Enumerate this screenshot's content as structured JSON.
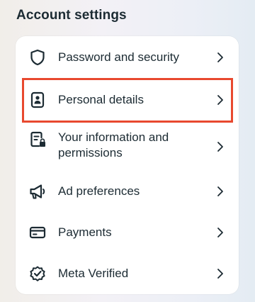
{
  "section": {
    "title": "Account settings"
  },
  "items": [
    {
      "label": "Password and security",
      "icon": "shield-icon"
    },
    {
      "label": "Personal details",
      "icon": "id-card-icon"
    },
    {
      "label": "Your information and permissions",
      "label_line1": "Your information and",
      "label_line2": "permissions",
      "icon": "document-lock-icon"
    },
    {
      "label": "Ad preferences",
      "icon": "megaphone-icon"
    },
    {
      "label": "Payments",
      "icon": "credit-card-icon"
    },
    {
      "label": "Meta Verified",
      "icon": "verified-badge-icon"
    }
  ],
  "colors": {
    "text": "#1c2b33",
    "highlight": "#e8492f",
    "card": "#ffffff"
  }
}
